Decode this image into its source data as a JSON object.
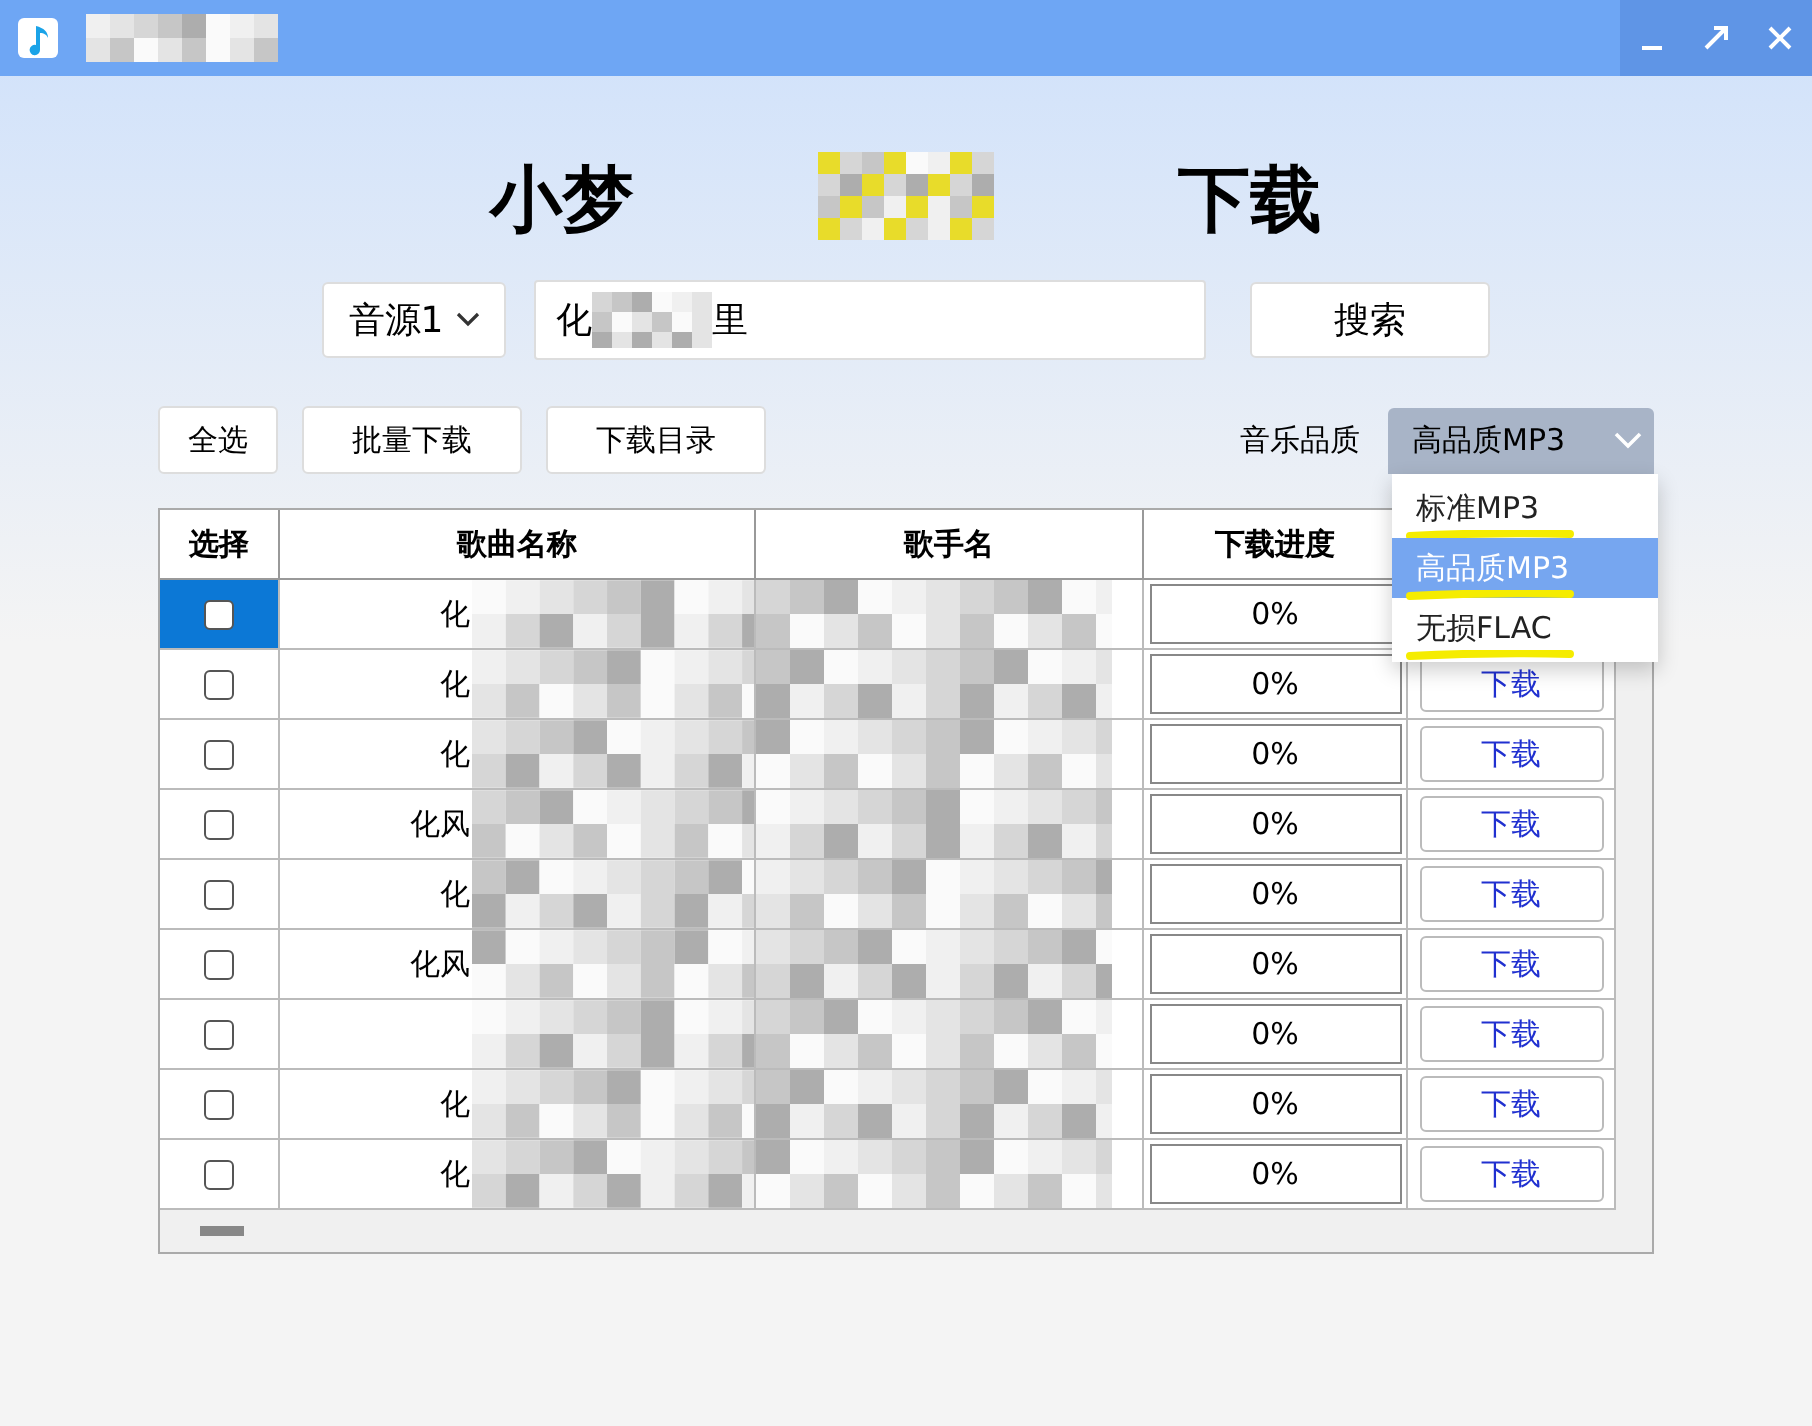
{
  "title_start": "小梦",
  "title_end": "下载",
  "search": {
    "source": "音源1",
    "query_start": "化",
    "query_end": "里",
    "button": "搜索"
  },
  "toolbar": [
    "全选",
    "批量下载",
    "下载目录"
  ],
  "quality": {
    "label": "音乐品质",
    "value": "高品质MP3",
    "expanded": true,
    "options": [
      {
        "label": "标准MP3",
        "selected": false
      },
      {
        "label": "高品质MP3",
        "selected": true
      },
      {
        "label": "无损FLAC",
        "selected": false
      }
    ]
  },
  "table": {
    "columns": [
      "选择",
      "歌曲名称",
      "歌手名",
      "下载进度"
    ],
    "rows": [
      {
        "selected": true,
        "checked": false,
        "song": "化",
        "progress": "0%"
      },
      {
        "selected": false,
        "checked": false,
        "song": "化",
        "progress": "0%",
        "action": "下载"
      },
      {
        "selected": false,
        "checked": false,
        "song": "化",
        "progress": "0%",
        "action": "下载"
      },
      {
        "selected": false,
        "checked": false,
        "song": "化风",
        "progress": "0%",
        "action": "下载"
      },
      {
        "selected": false,
        "checked": false,
        "song": "化",
        "progress": "0%",
        "action": "下载"
      },
      {
        "selected": false,
        "checked": false,
        "song": "化风",
        "progress": "0%",
        "action": "下载"
      },
      {
        "selected": false,
        "checked": false,
        "progress": "0%",
        "action": "下载"
      },
      {
        "selected": false,
        "checked": false,
        "song": "化",
        "progress": "0%",
        "action": "下载"
      },
      {
        "selected": false,
        "checked": false,
        "song": "化",
        "progress": "0%",
        "action": "下载"
      }
    ]
  }
}
